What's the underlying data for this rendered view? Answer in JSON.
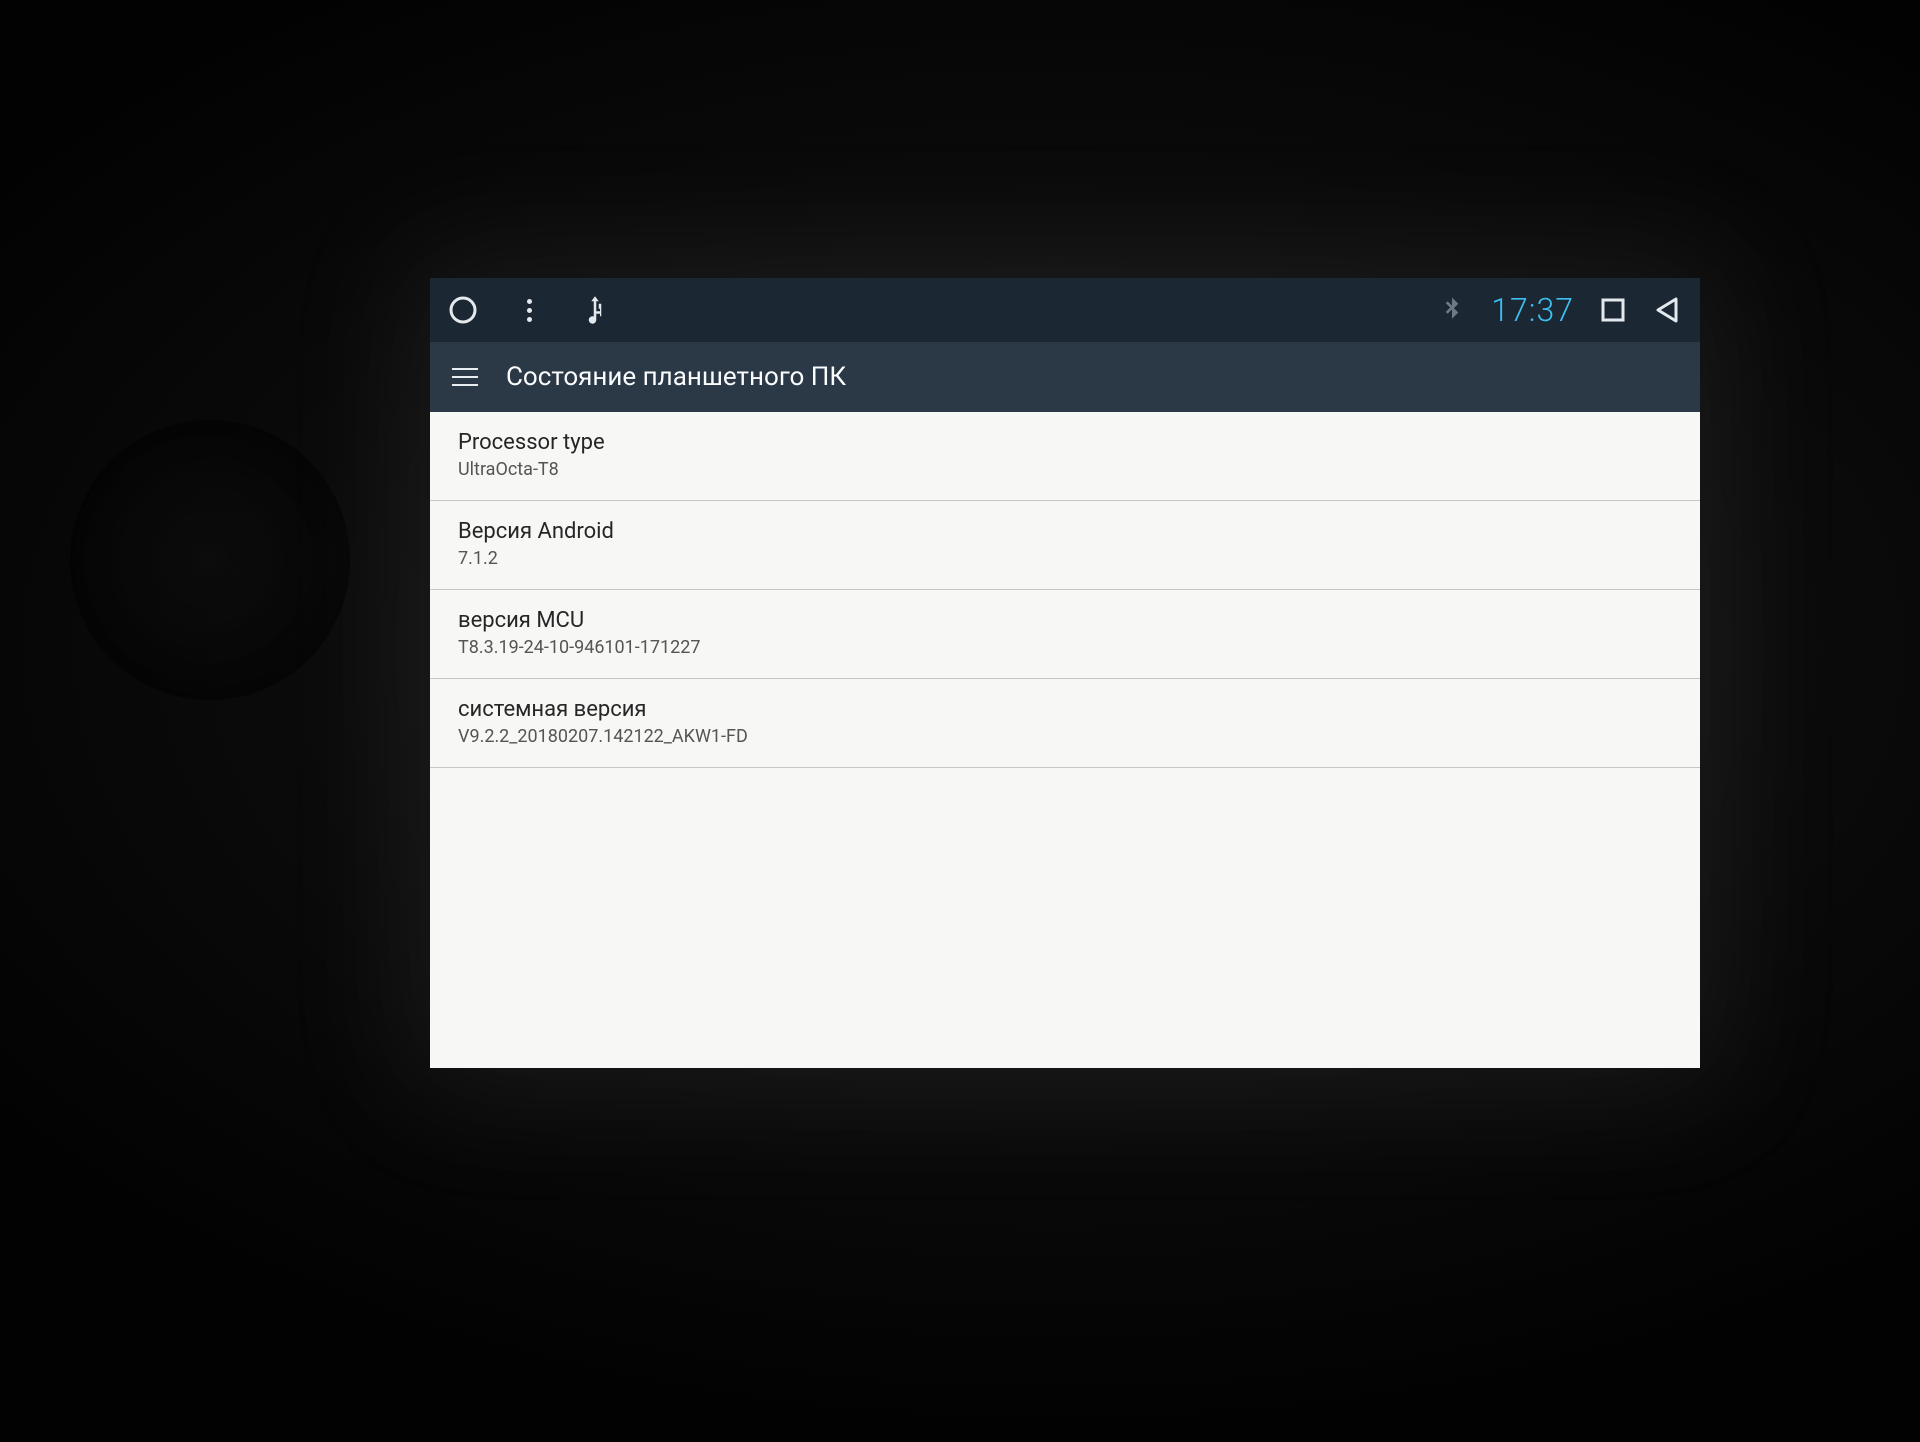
{
  "statusbar": {
    "clock": "17:37"
  },
  "header": {
    "title": "Состояние планшетного ПК"
  },
  "rows": [
    {
      "label": "Processor type",
      "value": "UltraOcta-T8"
    },
    {
      "label": "Версия Android",
      "value": "7.1.2"
    },
    {
      "label": "версия MCU",
      "value": "T8.3.19-24-10-946101-171227"
    },
    {
      "label": "системная версия",
      "value": "V9.2.2_20180207.142122_AKW1-FD"
    }
  ]
}
